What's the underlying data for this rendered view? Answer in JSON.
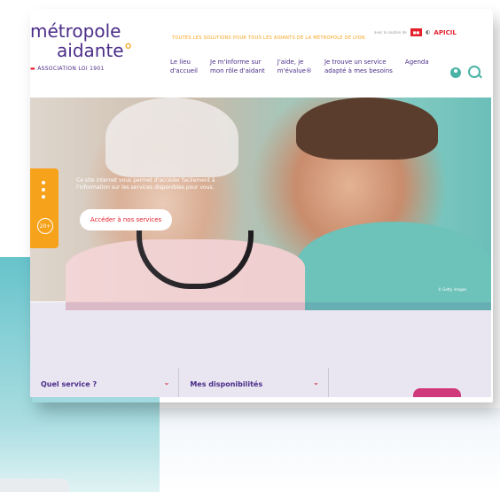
{
  "header": {
    "logo_line1": "métropole",
    "logo_line2": "aidante",
    "logo_assoc": "ASSOCIATION LOI 1901",
    "tagline": "TOUTES LES SOLUTIONS POUR TOUS LES AIDANTS DE LA MÉTROPOLE DE LYON",
    "partners_text": "avec le soutien de",
    "partner_apicil": "APICIL"
  },
  "nav": {
    "items": [
      {
        "label": "Le lieu\nd'accueil"
      },
      {
        "label": "Je m'informe sur\nmon rôle d'aidant"
      },
      {
        "label": "J'aide, je\nm'évalue®"
      },
      {
        "label": "Je trouve un service\nadapté à mes besoins"
      },
      {
        "label": "Agenda"
      }
    ]
  },
  "hero": {
    "text": "Ce site internet vous permet d'accéder facilement à l'information sur les services disponibles pour vous.",
    "cta_label": "Accéder à nos services",
    "slider_label": "20+",
    "credit": "© Getty images"
  },
  "band": {
    "title_bold": "Je trouve un service",
    "title_rest": " adapté à mes besoins"
  },
  "search": {
    "service_label": "Quel service ?",
    "dispo_label": "Mes disponibilités"
  },
  "colors": {
    "purple": "#4b2a8a",
    "orange": "#f7a21b",
    "red": "#e4202d",
    "teal": "#4ab3a5"
  }
}
